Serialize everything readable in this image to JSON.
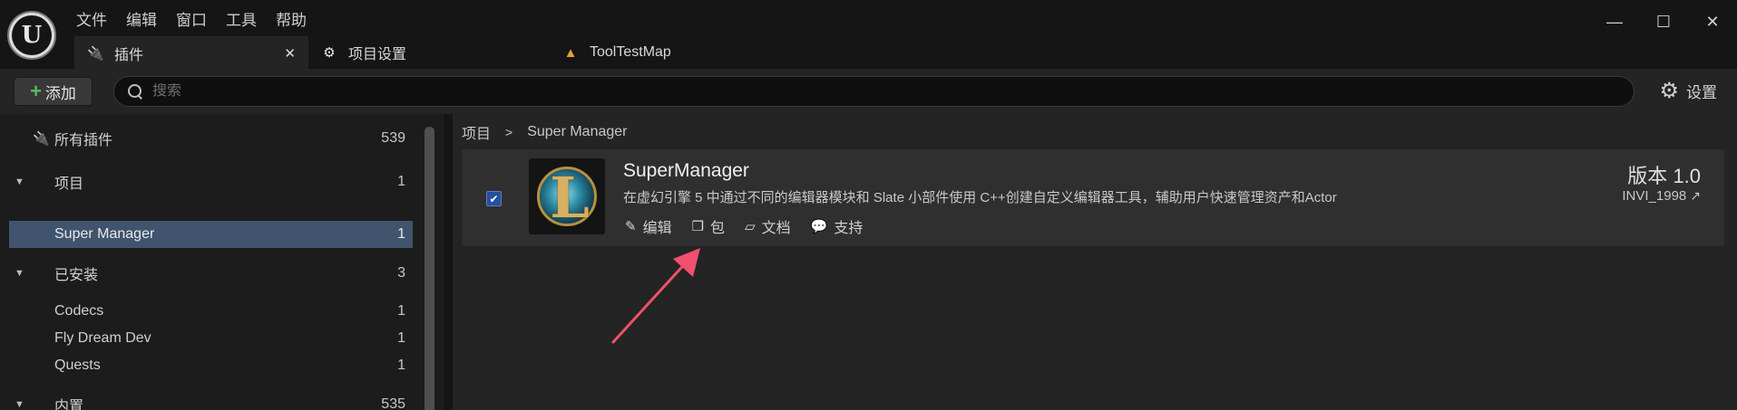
{
  "menu": [
    "文件",
    "编辑",
    "窗口",
    "工具",
    "帮助"
  ],
  "tabs": [
    {
      "label": "插件",
      "icon": "plugin-icon"
    },
    {
      "label": "项目设置",
      "icon": "settings-cube-icon"
    },
    {
      "label": "ToolTestMap",
      "icon": "map-icon"
    }
  ],
  "window": {
    "minimize": "—",
    "maximize": "☐",
    "close": "✕"
  },
  "toolbar": {
    "add_label": "添加",
    "search_placeholder": "搜索",
    "settings_label": "设置"
  },
  "sidebar": {
    "all_plugins": {
      "label": "所有插件",
      "count": "539"
    },
    "items": [
      {
        "label": "项目",
        "count": "1",
        "type": "group"
      },
      {
        "label": "Super Manager",
        "count": "1",
        "type": "item",
        "selected": true
      },
      {
        "label": "已安装",
        "count": "3",
        "type": "group"
      },
      {
        "label": "Codecs",
        "count": "1",
        "type": "item"
      },
      {
        "label": "Fly Dream Dev",
        "count": "1",
        "type": "item"
      },
      {
        "label": "Quests",
        "count": "1",
        "type": "item"
      },
      {
        "label": "内置",
        "count": "535",
        "type": "group"
      }
    ]
  },
  "breadcrumb": {
    "root": "项目",
    "current": "Super Manager"
  },
  "plugin": {
    "name": "SuperManager",
    "description": "在虚幻引擎 5 中通过不同的编辑器模块和 Slate 小部件使用 C++创建自定义编辑器工具，辅助用户快速管理资产和Actor",
    "version": "版本 1.0",
    "author": "INVI_1998",
    "enabled": true,
    "actions": [
      {
        "label": "编辑",
        "icon": "pencil-icon"
      },
      {
        "label": "包",
        "icon": "package-icon"
      },
      {
        "label": "文档",
        "icon": "document-icon"
      },
      {
        "label": "支持",
        "icon": "chat-icon"
      }
    ]
  },
  "colors": {
    "accent_selected": "#40546e",
    "checkbox": "#264f9c",
    "annotation_arrow": "#f0506e"
  }
}
